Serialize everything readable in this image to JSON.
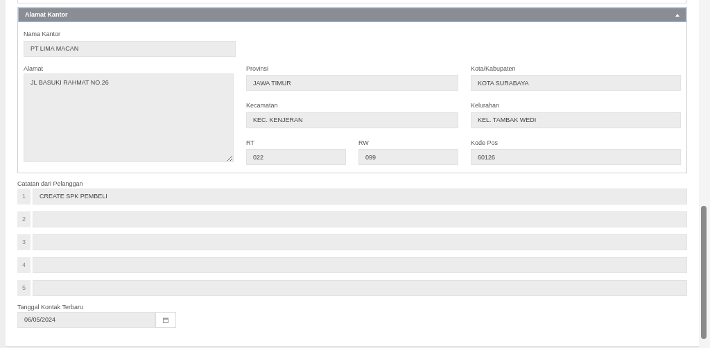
{
  "office_address": {
    "title": "Alamat Kantor",
    "expanded": true,
    "office_name": {
      "label": "Nama Kantor",
      "value": "PT LIMA MACAN"
    },
    "address": {
      "label": "Alamat",
      "value": "JL BASUKI RAHMAT NO.26"
    },
    "province": {
      "label": "Provinsi",
      "value": "JAWA TIMUR"
    },
    "city": {
      "label": "Kota/Kabupaten",
      "value": "KOTA SURABAYA"
    },
    "district": {
      "label": "Kecamatan",
      "value": "KEC. KENJERAN"
    },
    "subdistrict": {
      "label": "Kelurahan",
      "value": "KEL. TAMBAK WEDI"
    },
    "rt": {
      "label": "RT",
      "value": "022"
    },
    "rw": {
      "label": "RW",
      "value": "099"
    },
    "postal_code": {
      "label": "Kode Pos",
      "value": "60126"
    }
  },
  "customer_notes": {
    "label": "Catatan dari Pelanggan",
    "rows": [
      {
        "number": "1",
        "value": "CREATE SPK PEMBELI"
      },
      {
        "number": "2"
      },
      {
        "number": "3"
      },
      {
        "number": "4"
      },
      {
        "number": "5"
      }
    ]
  },
  "last_contact": {
    "label": "Tanggal Kontak Terbaru",
    "value": "06/05/2024"
  }
}
